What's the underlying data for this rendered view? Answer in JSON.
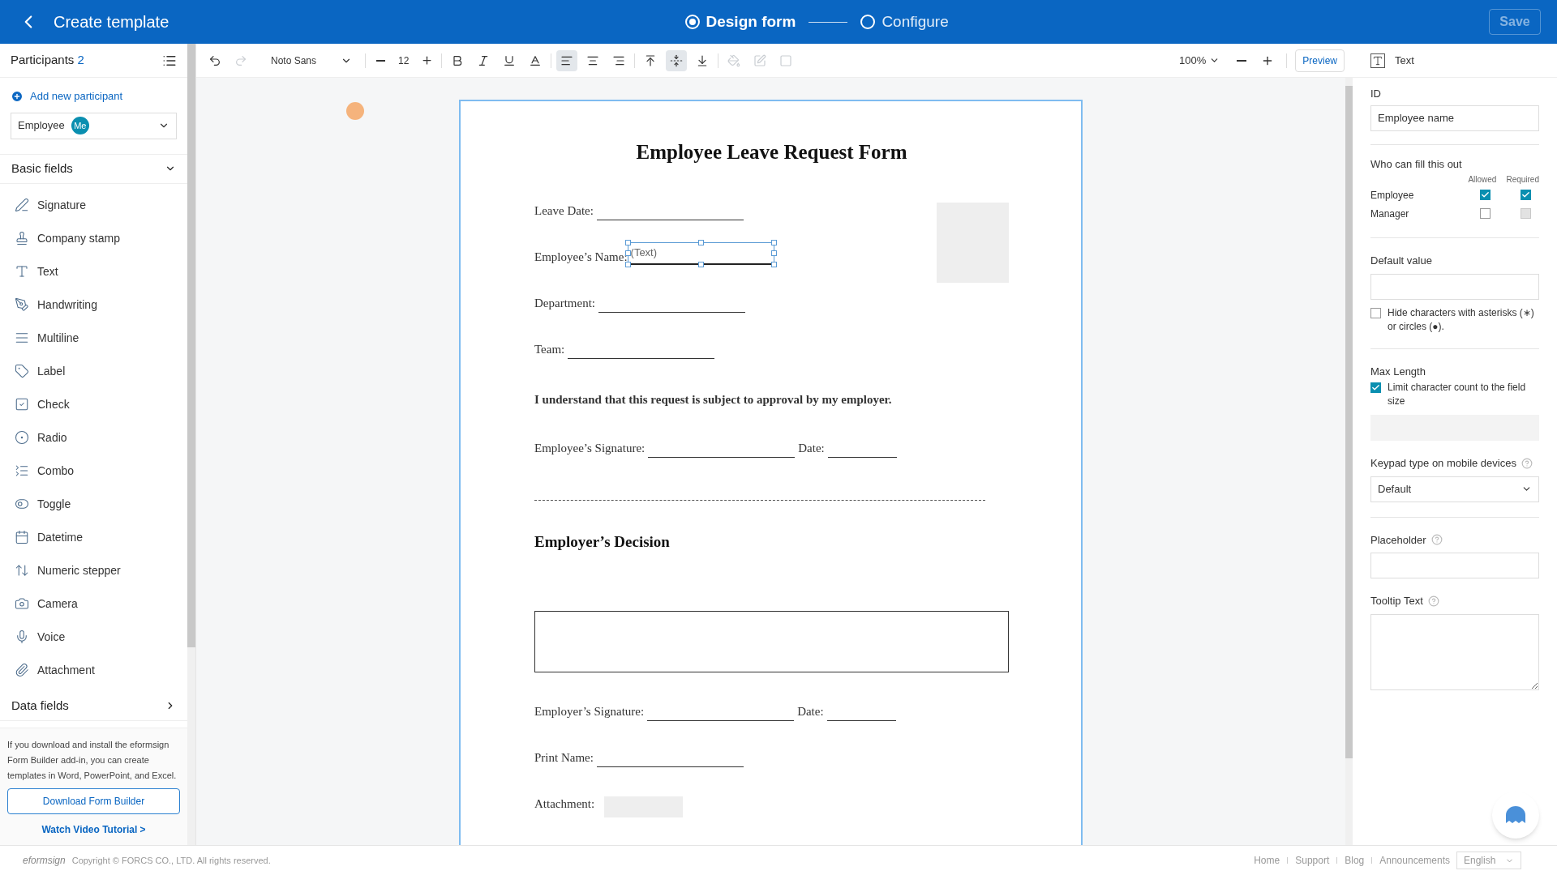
{
  "header": {
    "title": "Create template",
    "steps": [
      {
        "label": "Design form",
        "selected": true
      },
      {
        "label": "Configure",
        "selected": false
      }
    ],
    "save": {
      "label": "Save",
      "disabled": true
    }
  },
  "sidebar": {
    "participants": {
      "label": "Participants",
      "count": "2"
    },
    "add_participant": "Add new participant",
    "participant_select": {
      "value": "Employee",
      "badge": "Me"
    },
    "sections": [
      {
        "title": "Basic fields",
        "expanded": true,
        "items": [
          "Signature",
          "Company stamp",
          "Text",
          "Handwriting",
          "Multiline",
          "Label",
          "Check",
          "Radio",
          "Combo",
          "Toggle",
          "Datetime",
          "Numeric stepper",
          "Camera",
          "Voice",
          "Attachment"
        ]
      },
      {
        "title": "Data fields",
        "expanded": false
      }
    ],
    "promo": {
      "text": "If you download and install the eformsign Form Builder add-in, you can create templates in Word, PowerPoint, and Excel.",
      "download": "Download Form Builder",
      "video": "Watch Video Tutorial >"
    }
  },
  "toolbar": {
    "font": "Noto Sans",
    "font_size": "12",
    "zoom": "100%",
    "preview": "Preview",
    "tools": [
      {
        "kind": "undo",
        "selected": false,
        "disabled": false
      },
      {
        "kind": "redo",
        "selected": false,
        "disabled": true
      },
      {
        "kind": "bold",
        "selected": false,
        "disabled": false
      },
      {
        "kind": "italic",
        "selected": false,
        "disabled": false
      },
      {
        "kind": "underline",
        "selected": false,
        "disabled": false
      },
      {
        "kind": "font-color",
        "selected": false,
        "disabled": false
      },
      {
        "kind": "align-left",
        "selected": true,
        "disabled": false
      },
      {
        "kind": "align-center",
        "selected": false,
        "disabled": false
      },
      {
        "kind": "align-right",
        "selected": false,
        "disabled": false
      },
      {
        "kind": "valign-top",
        "selected": false,
        "disabled": false
      },
      {
        "kind": "valign-middle",
        "selected": true,
        "disabled": false
      },
      {
        "kind": "valign-bottom",
        "selected": false,
        "disabled": false
      },
      {
        "kind": "fill",
        "selected": false,
        "disabled": true
      },
      {
        "kind": "border",
        "selected": false,
        "disabled": true
      },
      {
        "kind": "line-style",
        "selected": false,
        "disabled": true
      }
    ]
  },
  "document": {
    "title": "Employee Leave Request Form",
    "lines": [
      {
        "kind": "blank",
        "label": "Leave Date:"
      },
      {
        "kind": "text_field",
        "label": "Employee’s Name:",
        "placeholder": "(Text)"
      },
      {
        "kind": "blank",
        "label": "Department:"
      },
      {
        "kind": "blank",
        "label": "Team:"
      },
      {
        "kind": "statement",
        "label": "I understand that this request is subject to approval by my employer."
      },
      {
        "kind": "signature",
        "label": "Employee’s Signature:",
        "date": "Date:"
      },
      {
        "kind": "divider"
      },
      {
        "kind": "heading",
        "label": "Employer’s Decision"
      },
      {
        "kind": "box"
      },
      {
        "kind": "signature",
        "label": "Employer’s Signature:",
        "date": "Date:"
      },
      {
        "kind": "blank",
        "label": "Print Name:"
      },
      {
        "kind": "attachment",
        "label": "Attachment:"
      }
    ]
  },
  "properties": {
    "type": "Text",
    "id": {
      "label": "ID",
      "value": "Employee name"
    },
    "fill": {
      "title": "Who can fill this out",
      "columns": [
        "Allowed",
        "Required"
      ],
      "rows": [
        {
          "name": "Employee",
          "allowed": true,
          "required": true,
          "required_disabled": false
        },
        {
          "name": "Manager",
          "allowed": false,
          "required": false,
          "required_disabled": true
        }
      ]
    },
    "default_value": {
      "label": "Default value"
    },
    "hide_chars": {
      "label": "Hide characters with asterisks (∗) or circles (●).",
      "checked": false
    },
    "max_length": {
      "label": "Max Length",
      "limit": {
        "label": "Limit character count to the field size",
        "checked": true
      }
    },
    "keypad": {
      "label": "Keypad type on mobile devices",
      "value": "Default"
    },
    "placeholder": {
      "label": "Placeholder"
    },
    "tooltip": {
      "label": "Tooltip Text"
    }
  },
  "footer": {
    "logo": "eformsign",
    "copyright": "Copyright © FORCS CO., LTD. All rights reserved.",
    "links": [
      "Home",
      "Support",
      "Blog",
      "Announcements"
    ],
    "language": "English"
  }
}
